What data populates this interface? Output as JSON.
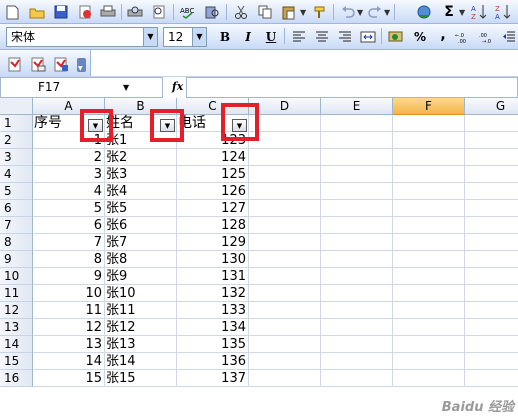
{
  "toolbar1": {
    "icons": [
      "new-icon",
      "open-icon",
      "save-icon",
      "permission-icon",
      "print-icon",
      "print-preview-icon",
      "spelling-icon",
      "research-icon",
      "cut-icon",
      "copy-icon",
      "paste-icon",
      "format-painter-icon",
      "undo-icon",
      "redo-icon",
      "hyperlink-icon",
      "autosum-icon",
      "sort-ascending-icon",
      "sort-descending-icon"
    ]
  },
  "toolbar2": {
    "font_name": "宋体",
    "font_size": "12",
    "bold": "B",
    "italic": "I",
    "underline": "U",
    "percent": "%",
    "comma": ","
  },
  "name_box": "F17",
  "fx_label": "fx",
  "formula_value": "",
  "column_headers": [
    "A",
    "B",
    "C",
    "D",
    "E",
    "F",
    "G"
  ],
  "active_column": "F",
  "header_row": [
    "序号",
    "姓名",
    "电话"
  ],
  "rows": [
    {
      "num": "2",
      "a": "1",
      "b": "张1",
      "c": "123"
    },
    {
      "num": "3",
      "a": "2",
      "b": "张2",
      "c": "124"
    },
    {
      "num": "4",
      "a": "3",
      "b": "张3",
      "c": "125"
    },
    {
      "num": "5",
      "a": "4",
      "b": "张4",
      "c": "126"
    },
    {
      "num": "6",
      "a": "5",
      "b": "张5",
      "c": "127"
    },
    {
      "num": "7",
      "a": "6",
      "b": "张6",
      "c": "128"
    },
    {
      "num": "8",
      "a": "7",
      "b": "张7",
      "c": "129"
    },
    {
      "num": "9",
      "a": "8",
      "b": "张8",
      "c": "130"
    },
    {
      "num": "10",
      "a": "9",
      "b": "张9",
      "c": "131"
    },
    {
      "num": "11",
      "a": "10",
      "b": "张10",
      "c": "132"
    },
    {
      "num": "12",
      "a": "11",
      "b": "张11",
      "c": "133"
    },
    {
      "num": "13",
      "a": "12",
      "b": "张12",
      "c": "134"
    },
    {
      "num": "14",
      "a": "13",
      "b": "张13",
      "c": "135"
    },
    {
      "num": "15",
      "a": "14",
      "b": "张14",
      "c": "136"
    },
    {
      "num": "16",
      "a": "15",
      "b": "张15",
      "c": "137"
    }
  ],
  "first_row_num": "1",
  "colors": {
    "highlight": "#e3202a",
    "active_header": "#f5b34a"
  },
  "watermark": "Baidu 经验"
}
